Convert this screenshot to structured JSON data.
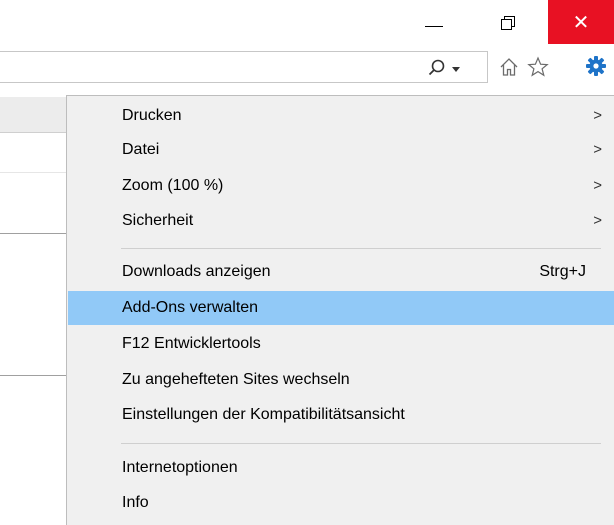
{
  "window_controls": {
    "close_color": "#e81123",
    "minimize_icon": "minimize-icon",
    "restore_icon": "restore-icon",
    "close_icon": "close-icon",
    "close_glyph": "✕"
  },
  "toolbar": {
    "search_icon": "search-icon",
    "home_icon": "home-icon",
    "favorites_icon": "star-icon",
    "tools_icon": "gear-icon",
    "tools_color": "#1e73c8"
  },
  "menu": {
    "highlight_color": "#91c9f7",
    "groups": [
      [
        {
          "label": "Drucken",
          "submenu": true,
          "chevron": ">"
        },
        {
          "label": "Datei",
          "submenu": true,
          "chevron": ">"
        },
        {
          "label": "Zoom (100 %)",
          "submenu": true,
          "chevron": ">"
        },
        {
          "label": "Sicherheit",
          "submenu": true,
          "chevron": ">"
        }
      ],
      [
        {
          "label": "Downloads anzeigen",
          "shortcut": "Strg+J"
        },
        {
          "label": "Add-Ons verwalten",
          "highlighted": true
        },
        {
          "label": "F12 Entwicklertools"
        },
        {
          "label": "Zu angehefteten Sites wechseln"
        },
        {
          "label": "Einstellungen der Kompatibilitätsansicht"
        }
      ],
      [
        {
          "label": "Internetoptionen"
        },
        {
          "label": "Info"
        }
      ]
    ]
  }
}
